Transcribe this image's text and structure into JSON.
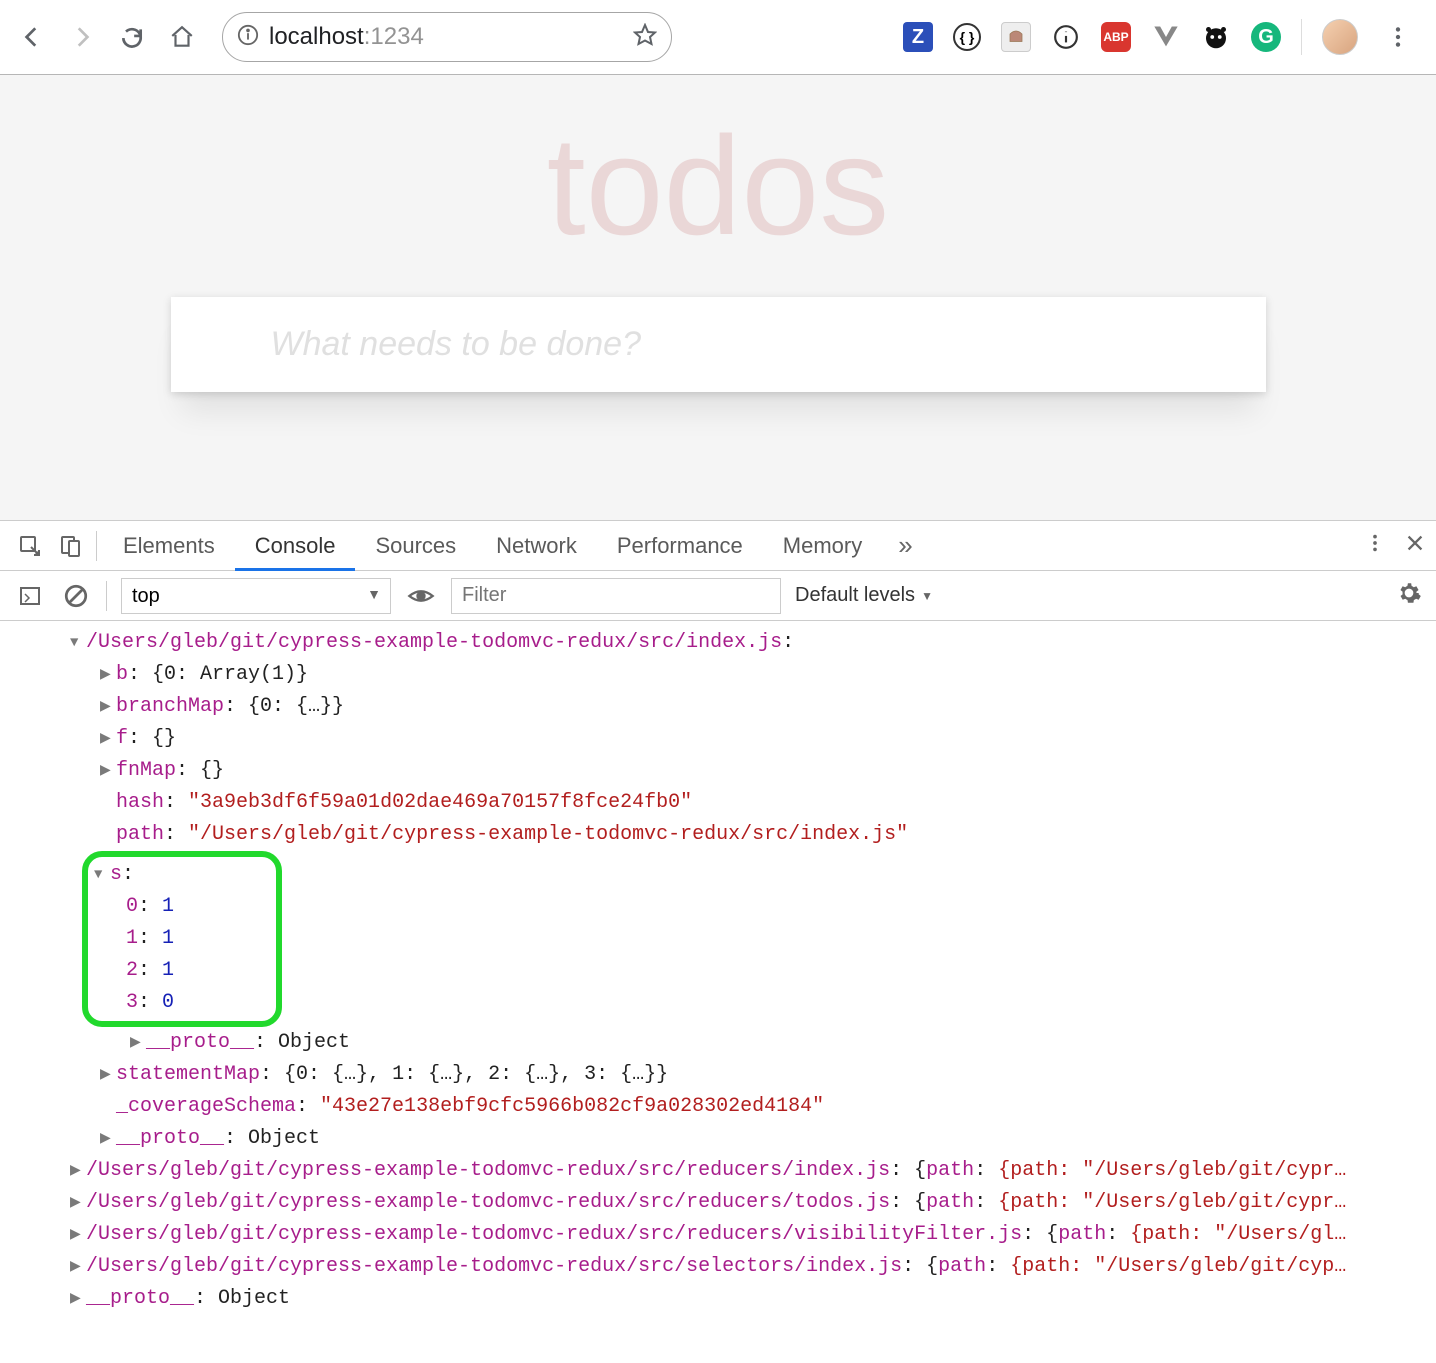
{
  "browser": {
    "url_host": "localhost",
    "url_port": ":1234"
  },
  "page": {
    "title": "todos",
    "input_placeholder": "What needs to be done?"
  },
  "devtools": {
    "tabs": [
      "Elements",
      "Console",
      "Sources",
      "Network",
      "Performance",
      "Memory"
    ],
    "active_tab": "Console",
    "more": "»",
    "context": "top",
    "filter_placeholder": "Filter",
    "levels": "Default levels"
  },
  "console": {
    "root_path": "/Users/gleb/git/cypress-example-todomvc-redux/src/index.js",
    "entries": {
      "b": "{0: Array(1)}",
      "branchMap": "{0: {…}}",
      "f": "{}",
      "fnMap": "{}",
      "hash": "\"3a9eb3df6f59a01d02dae469a70157f8fce24fb0\"",
      "path": "\"/Users/gleb/git/cypress-example-todomvc-redux/src/index.js\"",
      "s": {
        "0": 1,
        "1": 1,
        "2": 1,
        "3": 0
      },
      "proto_s": "Object",
      "statementMap": "{0: {…}, 1: {…}, 2: {…}, 3: {…}}",
      "_coverageSchema": "\"43e27e138ebf9cfc5966b082cf9a028302ed4184\"",
      "proto_root": "Object"
    },
    "collapsed": [
      {
        "path": "/Users/gleb/git/cypress-example-todomvc-redux/src/reducers/index.js",
        "preview": "{path: \"/Users/gleb/git/cypr…"
      },
      {
        "path": "/Users/gleb/git/cypress-example-todomvc-redux/src/reducers/todos.js",
        "preview": "{path: \"/Users/gleb/git/cypr…"
      },
      {
        "path": "/Users/gleb/git/cypress-example-todomvc-redux/src/reducers/visibilityFilter.js",
        "preview": "{path: \"/Users/gl…"
      },
      {
        "path": "/Users/gleb/git/cypress-example-todomvc-redux/src/selectors/index.js",
        "preview": "{path: \"/Users/gleb/git/cyp…"
      }
    ],
    "proto_bottom": "Object"
  }
}
